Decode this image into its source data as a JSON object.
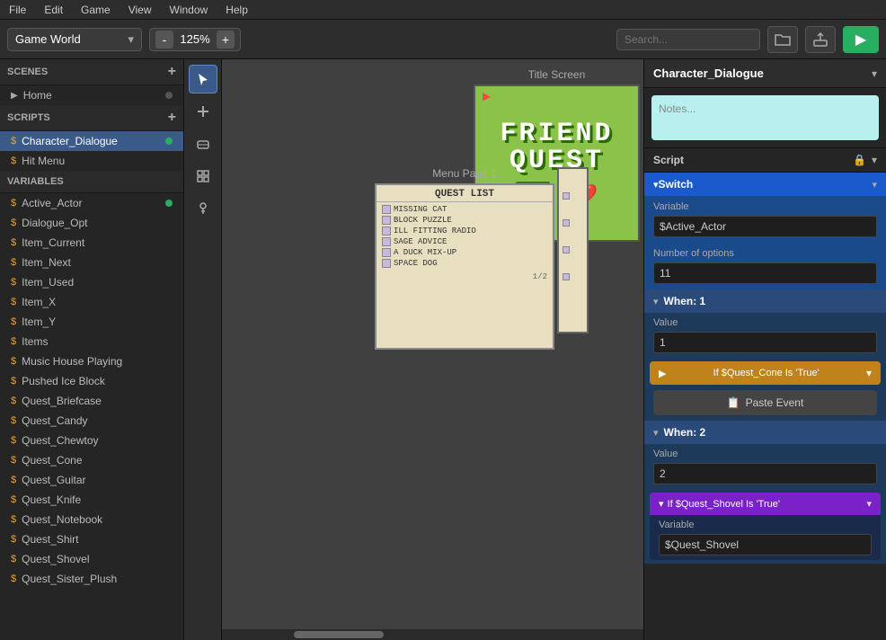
{
  "menubar": {
    "items": [
      "File",
      "Edit",
      "Game",
      "View",
      "Window",
      "Help"
    ]
  },
  "toolbar": {
    "world_selector": "Game World",
    "zoom_value": "125%",
    "zoom_minus": "-",
    "zoom_plus": "+",
    "search_placeholder": "Search...",
    "play_icon": "▶"
  },
  "sidebar": {
    "scenes_label": "SCENES",
    "scripts_label": "SCRIPTS",
    "variables_label": "VARIABLES",
    "scenes": [
      {
        "label": "Home",
        "has_dot": true
      }
    ],
    "scripts": [
      {
        "label": "Character_Dialogue",
        "selected": true,
        "has_dot": true
      },
      {
        "label": "Hit Menu",
        "has_dot": false
      }
    ],
    "variables": [
      {
        "label": "Active_Actor",
        "has_dot": true
      },
      {
        "label": "Dialogue_Opt",
        "has_dot": false
      },
      {
        "label": "Item_Current",
        "has_dot": false
      },
      {
        "label": "Item_Next",
        "has_dot": false
      },
      {
        "label": "Item_Used",
        "has_dot": false
      },
      {
        "label": "Item_X",
        "has_dot": false
      },
      {
        "label": "Item_Y",
        "has_dot": false
      },
      {
        "label": "Items",
        "has_dot": false
      },
      {
        "label": "Music House Playing",
        "has_dot": false
      },
      {
        "label": "Pushed Ice Block",
        "has_dot": false
      },
      {
        "label": "Quest_Briefcase",
        "has_dot": false
      },
      {
        "label": "Quest_Candy",
        "has_dot": false
      },
      {
        "label": "Quest_Chewtoy",
        "has_dot": false
      },
      {
        "label": "Quest_Cone",
        "has_dot": false
      },
      {
        "label": "Quest_Guitar",
        "has_dot": false
      },
      {
        "label": "Quest_Knife",
        "has_dot": false
      },
      {
        "label": "Quest_Notebook",
        "has_dot": false
      },
      {
        "label": "Quest_Shirt",
        "has_dot": false
      },
      {
        "label": "Quest_Shovel",
        "has_dot": false
      },
      {
        "label": "Quest_Sister_Plush",
        "has_dot": false
      }
    ]
  },
  "tools": [
    "cursor",
    "add",
    "eraser",
    "tile",
    "paint"
  ],
  "canvas": {
    "title_screen_label": "Title Screen",
    "menu_page_label": "Menu Page 1",
    "friend_quest": {
      "line1": "FRIEND",
      "line2": "QUEST"
    },
    "menu_page": {
      "title": "QUEST LIST",
      "items": [
        "MISSING CAT",
        "BLOCK PUZZLE",
        "ILL FITTING RADIO",
        "SAGE ADVICE",
        "A DUCK MIX-UP",
        "SPACE DOG"
      ],
      "footer": "1/2"
    }
  },
  "right_panel": {
    "title": "Character_Dialogue",
    "notes_placeholder": "Notes...",
    "script_label": "Script",
    "switch_label": "Switch",
    "variable_label": "Variable",
    "variable_value": "$Active_Actor",
    "num_options_label": "Number of options",
    "num_options_value": "11",
    "when1_label": "When: 1",
    "when1_value_label": "Value",
    "when1_value": "1",
    "if1_label": "If $Quest_Cone Is 'True'",
    "paste_event_label": "Paste Event",
    "when2_label": "When: 2",
    "when2_value_label": "Value",
    "when2_value": "2",
    "if2_label": "If $Quest_Shovel Is 'True'",
    "if2_var_label": "Variable",
    "if2_var_value": "$Quest_Shovel"
  }
}
